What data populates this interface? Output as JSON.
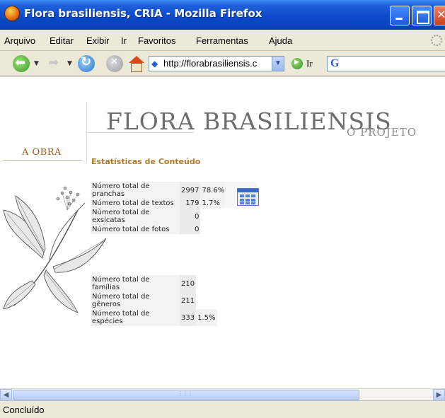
{
  "window": {
    "title": "Flora brasiliensis, CRIA - Mozilla Firefox"
  },
  "menu": [
    {
      "label": "Arquivo"
    },
    {
      "label": "Editar"
    },
    {
      "label": "Exibir"
    },
    {
      "label": "Ir"
    },
    {
      "label": "Favoritos"
    },
    {
      "label": "Ferramentas"
    },
    {
      "label": "Ajuda"
    }
  ],
  "toolbar": {
    "url": "http://florabrasiliensis.c",
    "go_label": "Ir",
    "search_logo": "G"
  },
  "page": {
    "brand": "FLORA BRASILIENSIS",
    "subbrand": "O PROJETO",
    "nav_link": "A OBRA",
    "section_title": "Estatísticas de Conteúdo",
    "stats_top": [
      {
        "label": "Número total de pranchas",
        "value": "2997",
        "pct": "78.6%"
      },
      {
        "label": "Número total de textos",
        "value": "179",
        "pct": "1.7%"
      },
      {
        "label": "Número total de exsicatas",
        "value": "0",
        "pct": ""
      },
      {
        "label": "Número total de fotos",
        "value": "0",
        "pct": ""
      }
    ],
    "stats_bottom": [
      {
        "label": "Número total de famílias",
        "value": "210",
        "pct": ""
      },
      {
        "label": "Número total de gêneros",
        "value": "211",
        "pct": ""
      },
      {
        "label": "Número total de espécies",
        "value": "333",
        "pct": "1.5%"
      }
    ]
  },
  "status": {
    "text": "Concluído"
  },
  "colors": {
    "title_bar": "#0b48c8",
    "accent_gold": "#b07a25",
    "brand_gray": "#6e6e6e",
    "nav_brown": "#a05a20"
  },
  "icons": [
    "firefox-icon",
    "back-icon",
    "forward-icon",
    "reload-icon",
    "stop-icon",
    "home-icon",
    "go-icon",
    "google-icon",
    "calendar-icon",
    "throbber-icon"
  ]
}
